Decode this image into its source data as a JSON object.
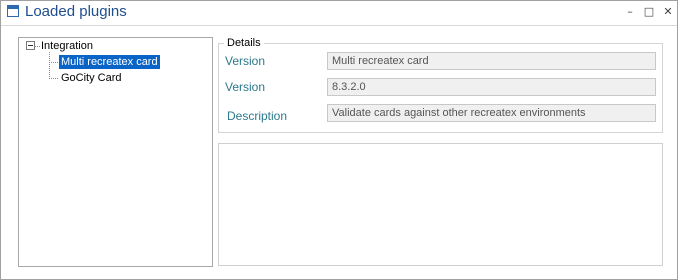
{
  "window": {
    "title": "Loaded plugins",
    "minimize_label": "–",
    "maximize_label": "□",
    "close_label": "✕"
  },
  "tree": {
    "root": {
      "label": "Integration",
      "expanded": true,
      "children": [
        {
          "label": "Multi recreatex card",
          "selected": true
        },
        {
          "label": "GoCity Card",
          "selected": false
        }
      ]
    }
  },
  "details": {
    "legend": "Details",
    "fields": [
      {
        "label": "Version",
        "value": "Multi recreatex card"
      },
      {
        "label": "Version",
        "value": "8.3.2.0"
      },
      {
        "label": "Description",
        "value": "Validate cards against other recreatex environments"
      }
    ]
  },
  "colors": {
    "selection": "#0a64c8",
    "label_teal": "#2b7a8c",
    "title_blue": "#1f4e8c"
  }
}
